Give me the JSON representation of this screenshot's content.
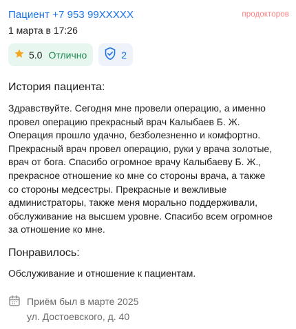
{
  "review": {
    "author": "Пациент +7 953 99XXXXX",
    "brand": "продокторов",
    "date": "1 марта в 17:26",
    "rating": {
      "value": "5.0",
      "label": "Отлично"
    },
    "verified_count": "2"
  },
  "history": {
    "title": "История пациента:",
    "lines": [
      "Здравствуйте. Сегодня мне провели операцию, а именно",
      "провел операцию прекрасный врач Калыбаев Б. Ж.",
      "Операция прошло удачно, безболезненно и комфортно.",
      "Прекрасный врач провел операцию, руки у врача золотые,",
      "врач от бога. Спасибо огромное врачу Калыбаеву Б. Ж.,",
      "прекрасное отношение ко мне со стороны врача, а также",
      "со стороны медсестры. Прекрасные и вежливые",
      "администраторы, также меня морально поддерживали,",
      "обслуживание на высшем уровне. Спасибо всем огромное",
      "за отношение ко мне."
    ]
  },
  "liked": {
    "title": "Понравилось:",
    "text": "Обслуживание и отношение к пациентам."
  },
  "visit": {
    "when": "Приём был в марте 2025",
    "address": "ул. Достоевского, д. 40"
  },
  "colors": {
    "link": "#1a73e8",
    "brand": "#ff7e7e",
    "rating_bg": "#e7f6ef",
    "rating_text": "#1f8a50",
    "star": "#f5a623",
    "verified_bg": "#eef3fb"
  },
  "icons": [
    "star-icon",
    "shield-check-icon",
    "calendar-icon"
  ]
}
